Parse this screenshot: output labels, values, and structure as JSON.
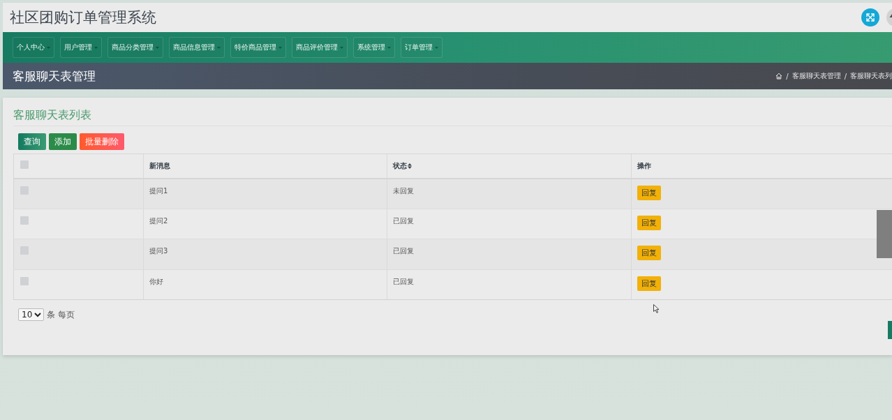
{
  "header": {
    "title": "社区团购订单管理系统"
  },
  "nav": {
    "items": [
      {
        "label": "个人中心",
        "dropdown": true
      },
      {
        "label": "用户管理",
        "dropdown": true
      },
      {
        "label": "商品分类管理",
        "dropdown": true
      },
      {
        "label": "商品信息管理",
        "dropdown": true
      },
      {
        "label": "特价商品管理",
        "dropdown": true
      },
      {
        "label": "商品评价管理",
        "dropdown": true
      },
      {
        "label": "系统管理",
        "dropdown": true
      },
      {
        "label": "订单管理",
        "dropdown": true
      }
    ]
  },
  "page_header": {
    "title": "客服聊天表管理",
    "breadcrumb": {
      "separator": "/",
      "items": [
        "客服聊天表管理",
        "客服聊天表列"
      ]
    }
  },
  "panel": {
    "title": "客服聊天表列表",
    "buttons": [
      {
        "label": "查询",
        "kind": "search"
      },
      {
        "label": "添加",
        "kind": "add"
      },
      {
        "label": "批量删除",
        "kind": "delete"
      }
    ],
    "table": {
      "select_all": {
        "checked": false
      },
      "columns": [
        {
          "label": "新消息",
          "sortable": false
        },
        {
          "label": "状态",
          "sortable": true
        },
        {
          "label": "操作",
          "sortable": false
        }
      ],
      "rows": [
        {
          "checked": false,
          "message": "提问1",
          "status": "未回复",
          "action": "回复"
        },
        {
          "checked": false,
          "message": "提问2",
          "status": "已回复",
          "action": "回复"
        },
        {
          "checked": false,
          "message": "提问3",
          "status": "已回复",
          "action": "回复"
        },
        {
          "checked": false,
          "message": "你好",
          "status": "已回复",
          "action": "回复"
        }
      ]
    },
    "pagination": {
      "page_size": "10",
      "suffix": "条 每页"
    }
  }
}
